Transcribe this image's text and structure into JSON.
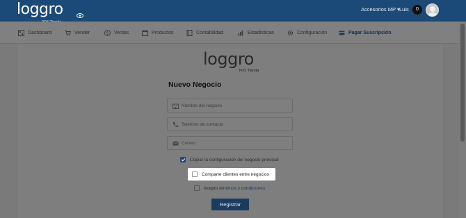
{
  "header": {
    "logo_text": "loggro",
    "logo_sub": "POS Tienda",
    "store_menu": "Accesorios MP",
    "user_name": "Luis",
    "notification_count": "0"
  },
  "nav": {
    "items": [
      {
        "label": "Dashboard",
        "icon": "dashboard-icon"
      },
      {
        "label": "Vender",
        "icon": "cart-icon"
      },
      {
        "label": "Ventas",
        "icon": "dollar-icon"
      },
      {
        "label": "Productos",
        "icon": "box-icon"
      },
      {
        "label": "Contabilidad",
        "icon": "book-icon"
      },
      {
        "label": "Estadísticas",
        "icon": "bar-chart-icon"
      },
      {
        "label": "Configuración",
        "icon": "gear-icon"
      },
      {
        "label": "Pagar Suscripción",
        "icon": "credit-card-icon"
      }
    ]
  },
  "form": {
    "logo_text": "loggro",
    "logo_sub": "POS Tienda",
    "title": "Nuevo Negocio",
    "business_name_placeholder": "Nombre del negocio",
    "phone_placeholder": "Teléfono de contacto",
    "email_placeholder": "Correo",
    "copy_config_label": "Copiar la configuración del negocio principal",
    "copy_config_checked": true,
    "share_clients_label": "Comparte clientes entre negocios",
    "share_clients_checked": false,
    "terms_prefix": "Acepto",
    "terms_link": "términos y condiciones",
    "terms_checked": false,
    "submit_label": "Registrar"
  },
  "colors": {
    "header_bg": "#1b4a78",
    "button_bg": "#1b3c5e",
    "overlay": "#7f7f7f"
  }
}
